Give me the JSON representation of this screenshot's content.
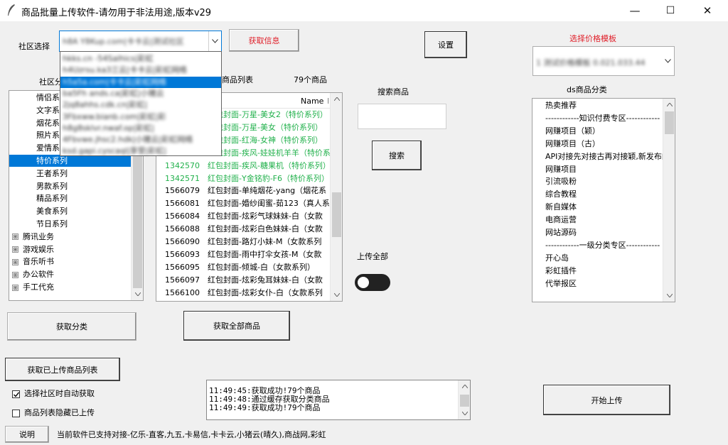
{
  "window": {
    "title": "商品批量上传软件-请勿用于非法用途,版本v29",
    "minimize": "—",
    "maximize": "☐",
    "close": "✕"
  },
  "community": {
    "label": "社区选择",
    "selected": "h8A Y8Kup.com|卡卡云|测试社区",
    "fetch_info_label": "获取信息",
    "dropdown_options": [
      "hkks.cn -54Salhics|彩虹",
      "h4Uzrsu.ka3三云|卡卡云|彩虹网络",
      "h5a5a.com|卡卡云|彩虹网络",
      "ba5Fh ands.ca|彩虹|小猪云",
      "2jq8ahhs.cdk.cn|彩虹|",
      "3Fbxww.bianb.com|彩虹|彩",
      "h8g8sklvr.nwaf.op|彩虹|",
      "4Fbvwe.jhsc2.hdk|小猪云|彩虹网络",
      "ksd.gapi.cyscaql|享受|彩虹|"
    ]
  },
  "category_tree": {
    "label": "社区分类",
    "items": [
      {
        "label": "情侣系列",
        "type": "child",
        "selected": false
      },
      {
        "label": "文字系列",
        "type": "child",
        "selected": false
      },
      {
        "label": "烟花系列",
        "type": "child",
        "selected": false
      },
      {
        "label": "照片系列",
        "type": "child",
        "selected": false
      },
      {
        "label": "爱情系列",
        "type": "child",
        "selected": false
      },
      {
        "label": "特价系列",
        "type": "child",
        "selected": true
      },
      {
        "label": "王者系列",
        "type": "child",
        "selected": false
      },
      {
        "label": "男款系列",
        "type": "child",
        "selected": false
      },
      {
        "label": "精品系列",
        "type": "child",
        "selected": false
      },
      {
        "label": "美食系列",
        "type": "child",
        "selected": false
      },
      {
        "label": "节日系列",
        "type": "child",
        "selected": false
      },
      {
        "label": "腾讯业务",
        "type": "group",
        "selected": false
      },
      {
        "label": "游戏娱乐",
        "type": "group",
        "selected": false
      },
      {
        "label": "音乐听书",
        "type": "group",
        "selected": false
      },
      {
        "label": "办公软件",
        "type": "group",
        "selected": false
      },
      {
        "label": "手工代充",
        "type": "group",
        "selected": false
      }
    ],
    "expander_glyph": "⊞",
    "fetch_button": "获取分类"
  },
  "product_list": {
    "label": "商品列表",
    "count": "79个商品",
    "column_name": "Name",
    "column_next": "I",
    "rows": [
      {
        "id": "",
        "name": "红包封面-万星-美女2（特价系列）",
        "color": "#22b14c"
      },
      {
        "id": "",
        "name": "红包封面-万星-美女（特价系列）",
        "color": "#22b14c"
      },
      {
        "id": "",
        "name": "红包封面-红海-女神（特价系列）",
        "color": "#22b14c"
      },
      {
        "id": "",
        "name": "红包封面-疾风-娃娃机羊羊（特价系",
        "color": "#22b14c"
      },
      {
        "id": "1342570",
        "name": "红包封面-疾风-糖果机（特价系列）",
        "color": "#22b14c"
      },
      {
        "id": "1342571",
        "name": "红包封面-Y金铭豹-F6（特价系列）",
        "color": "#22b14c"
      },
      {
        "id": "1566079",
        "name": "红包封面-单纯烟花-yang（烟花系",
        "color": "#000000"
      },
      {
        "id": "1566081",
        "name": "红包封面-婚纱闺蜜-茹123（真人系",
        "color": "#000000"
      },
      {
        "id": "1566084",
        "name": "红包封面-炫彩气球妹妹-白（女款",
        "color": "#000000"
      },
      {
        "id": "1566088",
        "name": "红包封面-炫彩白色妹妹-白（女款",
        "color": "#000000"
      },
      {
        "id": "1566090",
        "name": "红包封面-路灯小妹-M（女款系列",
        "color": "#000000"
      },
      {
        "id": "1566093",
        "name": "红包封面-雨中打伞女孩-M（女款",
        "color": "#000000"
      },
      {
        "id": "1566095",
        "name": "红包封面-倾城-白（女款系列）",
        "color": "#000000"
      },
      {
        "id": "1566097",
        "name": "红包封面-炫彩兔耳妹妹-白（女款",
        "color": "#000000"
      },
      {
        "id": "1566100",
        "name": "红包封面-炫彩女仆-白（女款系列",
        "color": "#000000"
      }
    ],
    "fetch_all_button": "获取全部商品"
  },
  "search": {
    "label": "搜索商品",
    "value": "",
    "button": "搜索"
  },
  "settings_button": "设置",
  "upload_all": {
    "label": "上传全部"
  },
  "price_template": {
    "label": "选择价格模板",
    "selected": "1 测试价格模板 0.021.033.44"
  },
  "ds_category": {
    "label": "ds商品分类",
    "items": [
      "热卖推荐",
      "------------知识付费专区------------",
      "网赚项目（颖）",
      "网赚项目（古）",
      "API对接先对接古再对接颖,新发布的",
      "网赚项目",
      "引流吸粉",
      "综合教程",
      "新自媒体",
      "电商运营",
      "网站源码",
      "------------一级分类专区------------",
      "开心岛",
      "彩虹插件",
      "代举报区"
    ]
  },
  "fetch_uploaded_button": "获取已上传商品列表",
  "options": {
    "auto_fetch_label": "选择社区时自动获取",
    "hide_uploaded_label": "商品列表隐藏已上传"
  },
  "log": [
    "11:49:45:获取成功!79个商品",
    "11:49:48:通过缓存获取分类商品",
    "11:49:49:获取成功!79个商品"
  ],
  "start_upload_button": "开始上传",
  "help_button": "说明",
  "footer_text": "当前软件已支持对接-亿乐-直客,九五,卡易信,卡卡云,小猪云(晴久),商战网,彩虹"
}
